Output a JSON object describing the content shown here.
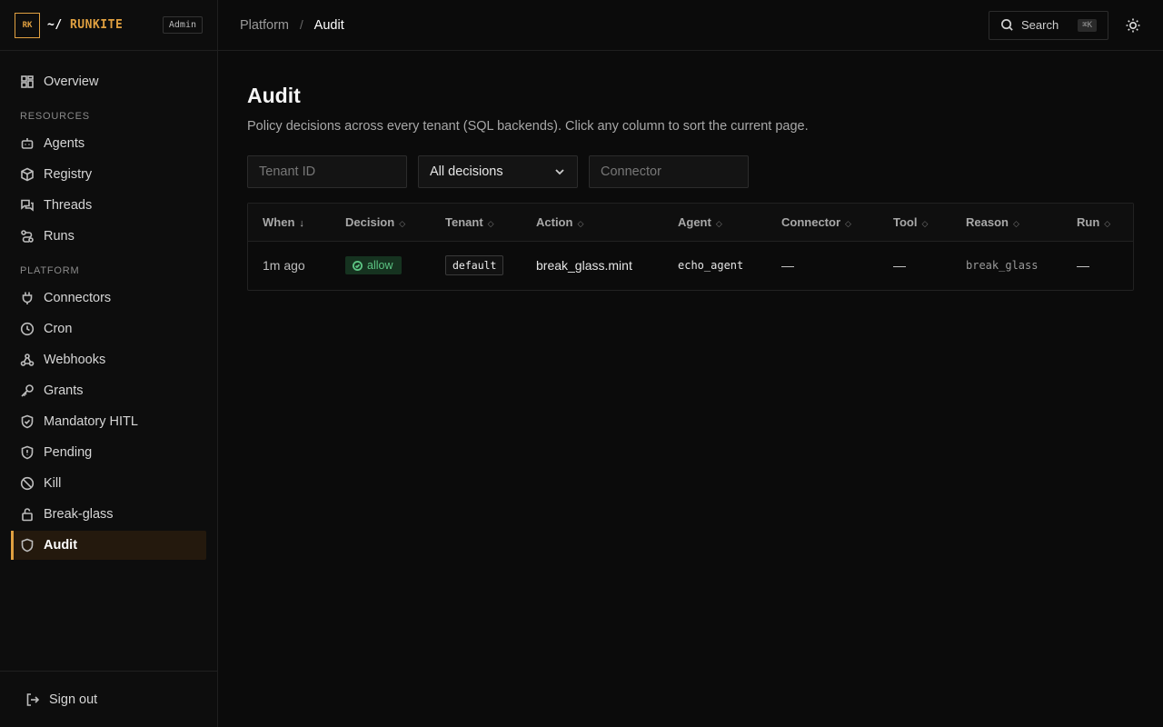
{
  "brand": {
    "logo_text": "RK",
    "prefix": "~/",
    "name": "RUNKITE",
    "role_badge": "Admin"
  },
  "sidebar": {
    "top_items": [
      {
        "label": "Overview",
        "icon": "grid-icon"
      }
    ],
    "sections": [
      {
        "title": "RESOURCES",
        "items": [
          {
            "label": "Agents",
            "icon": "bot-icon"
          },
          {
            "label": "Registry",
            "icon": "package-icon"
          },
          {
            "label": "Threads",
            "icon": "chat-icon"
          },
          {
            "label": "Runs",
            "icon": "route-icon"
          }
        ]
      },
      {
        "title": "PLATFORM",
        "items": [
          {
            "label": "Connectors",
            "icon": "plug-icon"
          },
          {
            "label": "Cron",
            "icon": "clock-icon"
          },
          {
            "label": "Webhooks",
            "icon": "webhook-icon"
          },
          {
            "label": "Grants",
            "icon": "key-icon"
          },
          {
            "label": "Mandatory HITL",
            "icon": "shield-check-icon"
          },
          {
            "label": "Pending",
            "icon": "shield-alert-icon"
          },
          {
            "label": "Kill",
            "icon": "ban-icon"
          },
          {
            "label": "Break-glass",
            "icon": "unlock-icon"
          },
          {
            "label": "Audit",
            "icon": "shield-icon",
            "active": true
          }
        ]
      }
    ],
    "footer": {
      "label": "Sign out",
      "icon": "logout-icon"
    }
  },
  "header": {
    "breadcrumb": [
      "Platform",
      "Audit"
    ],
    "search_label": "Search",
    "search_shortcut": "⌘K"
  },
  "page": {
    "title": "Audit",
    "description": "Policy decisions across every tenant (SQL backends). Click any column to sort the current page."
  },
  "filters": {
    "tenant_placeholder": "Tenant ID",
    "decision_selected": "All decisions",
    "connector_placeholder": "Connector"
  },
  "table": {
    "columns": [
      "When",
      "Decision",
      "Tenant",
      "Action",
      "Agent",
      "Connector",
      "Tool",
      "Reason",
      "Run"
    ],
    "sort_active_indicator": "↓",
    "sort_indicator": "◇",
    "rows": [
      {
        "when": "1m ago",
        "decision": "allow",
        "tenant": "default",
        "action": "break_glass.mint",
        "agent": "echo_agent",
        "connector": "—",
        "tool": "—",
        "reason": "break_glass",
        "run": "—"
      }
    ]
  },
  "colors": {
    "accent": "#e0a040",
    "allow_bg": "#163320",
    "allow_fg": "#5cc483",
    "background": "#0b0b0b"
  }
}
